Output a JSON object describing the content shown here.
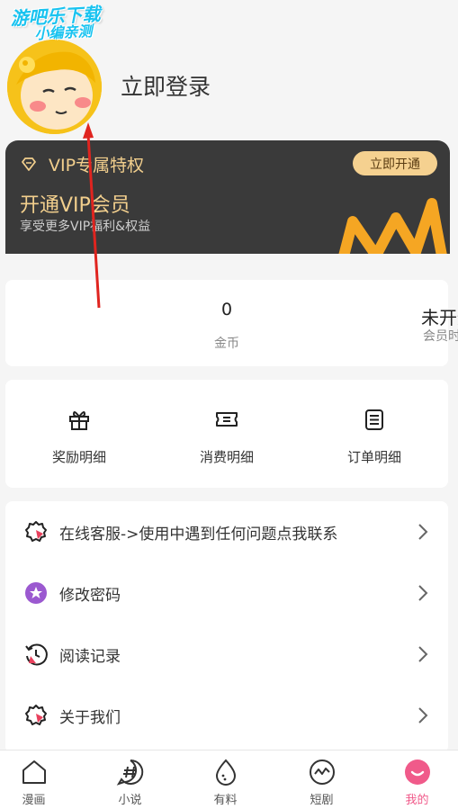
{
  "watermark": {
    "line1": "游吧乐下载",
    "line2": "小编亲测"
  },
  "profile": {
    "login_label": "立即登录"
  },
  "vip": {
    "title": "VIP专属特权",
    "button": "立即开通",
    "headline": "开通VIP会员",
    "subtitle": "享受更多VIP福利&权益",
    "accent_color": "#f2cf8d"
  },
  "stats": {
    "coins": {
      "value": "0",
      "label": "金币"
    },
    "membership": {
      "value": "未开通",
      "label": "会员时间"
    }
  },
  "shortcuts": [
    {
      "label": "奖励明细",
      "icon": "gift-icon"
    },
    {
      "label": "消费明细",
      "icon": "ticket-icon"
    },
    {
      "label": "订单明细",
      "icon": "list-icon"
    }
  ],
  "menu": [
    {
      "label": "在线客服->使用中遇到任何问题点我联系",
      "icon": "badge-check-icon"
    },
    {
      "label": "修改密码",
      "icon": "star-icon"
    },
    {
      "label": "阅读记录",
      "icon": "history-icon"
    },
    {
      "label": "关于我们",
      "icon": "badge-check-icon"
    }
  ],
  "tabs": [
    {
      "label": "漫画",
      "icon": "home-icon",
      "active": false
    },
    {
      "label": "小说",
      "icon": "hash-icon",
      "active": false
    },
    {
      "label": "有料",
      "icon": "egg-icon",
      "active": false
    },
    {
      "label": "短剧",
      "icon": "wave-icon",
      "active": false
    },
    {
      "label": "我的",
      "icon": "smile-icon",
      "active": true
    }
  ],
  "active_color": "#f05a8a"
}
